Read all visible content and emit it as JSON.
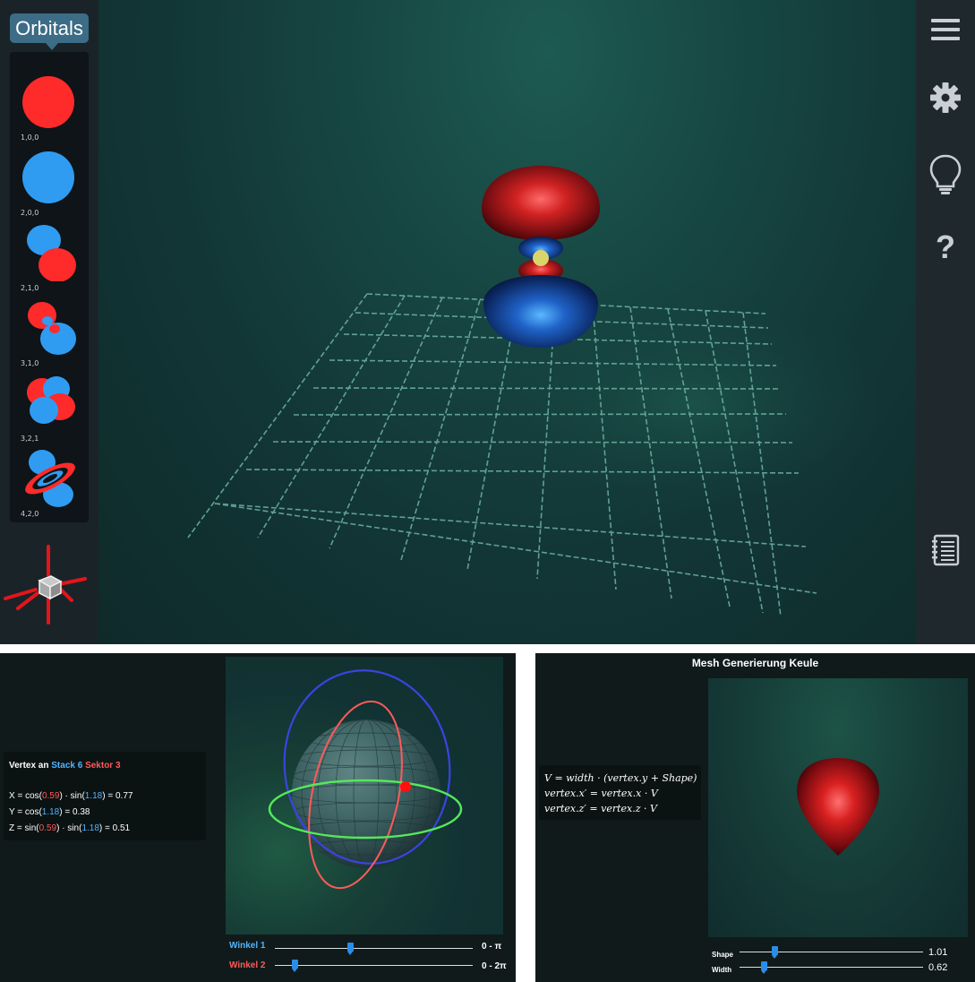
{
  "top": {
    "orbitals_tab": "Orbitals",
    "orbitals": [
      {
        "label": "1,0,0",
        "icon": "orbital-100-icon"
      },
      {
        "label": "2,0,0",
        "icon": "orbital-200-icon"
      },
      {
        "label": "2,1,0",
        "icon": "orbital-210-icon"
      },
      {
        "label": "3,1,0",
        "icon": "orbital-310-icon"
      },
      {
        "label": "3,2,1",
        "icon": "orbital-321-icon"
      },
      {
        "label": "4,2,0",
        "icon": "orbital-420-icon"
      }
    ],
    "right_icons": [
      "menu-icon",
      "gear-icon",
      "lightbulb-icon",
      "help-icon",
      "notebook-icon"
    ],
    "help_glyph": "?"
  },
  "bottom_left": {
    "vertex_title_prefix": "Vertex an",
    "vertex_stack": "Stack 6",
    "vertex_sector": "Sektor 3",
    "x_line": {
      "a": "X = cos(",
      "b": "0.59",
      "c": ") · sin(",
      "d": "1.18",
      "e": ") = 0.77"
    },
    "y_line": {
      "a": "Y = cos(",
      "b": "1.18",
      "c": ") = 0.38"
    },
    "z_line": {
      "a": "Z = sin(",
      "b": "0.59",
      "c": ") · sin(",
      "d": "1.18",
      "e": ") = 0.51"
    },
    "slider1": {
      "label": "Winkel 1",
      "range": "0 - π",
      "fraction": 0.38
    },
    "slider2": {
      "label": "Winkel 2",
      "range": "0 - 2π",
      "fraction": 0.1
    },
    "colors": {
      "blue": "#4fb5ff",
      "red": "#ff5a5a",
      "green": "#55e85a"
    }
  },
  "bottom_right": {
    "title": "Mesh Generierung Keule",
    "formula": [
      "V = width · (vertex.y + Shape)",
      "vertex.x′ = vertex.x · V",
      "vertex.z′ = vertex.z · V"
    ],
    "shape": {
      "label": "Shape",
      "value": "1.01",
      "fraction": 0.19
    },
    "width": {
      "label": "Width",
      "value": "0.62",
      "fraction": 0.13
    }
  }
}
